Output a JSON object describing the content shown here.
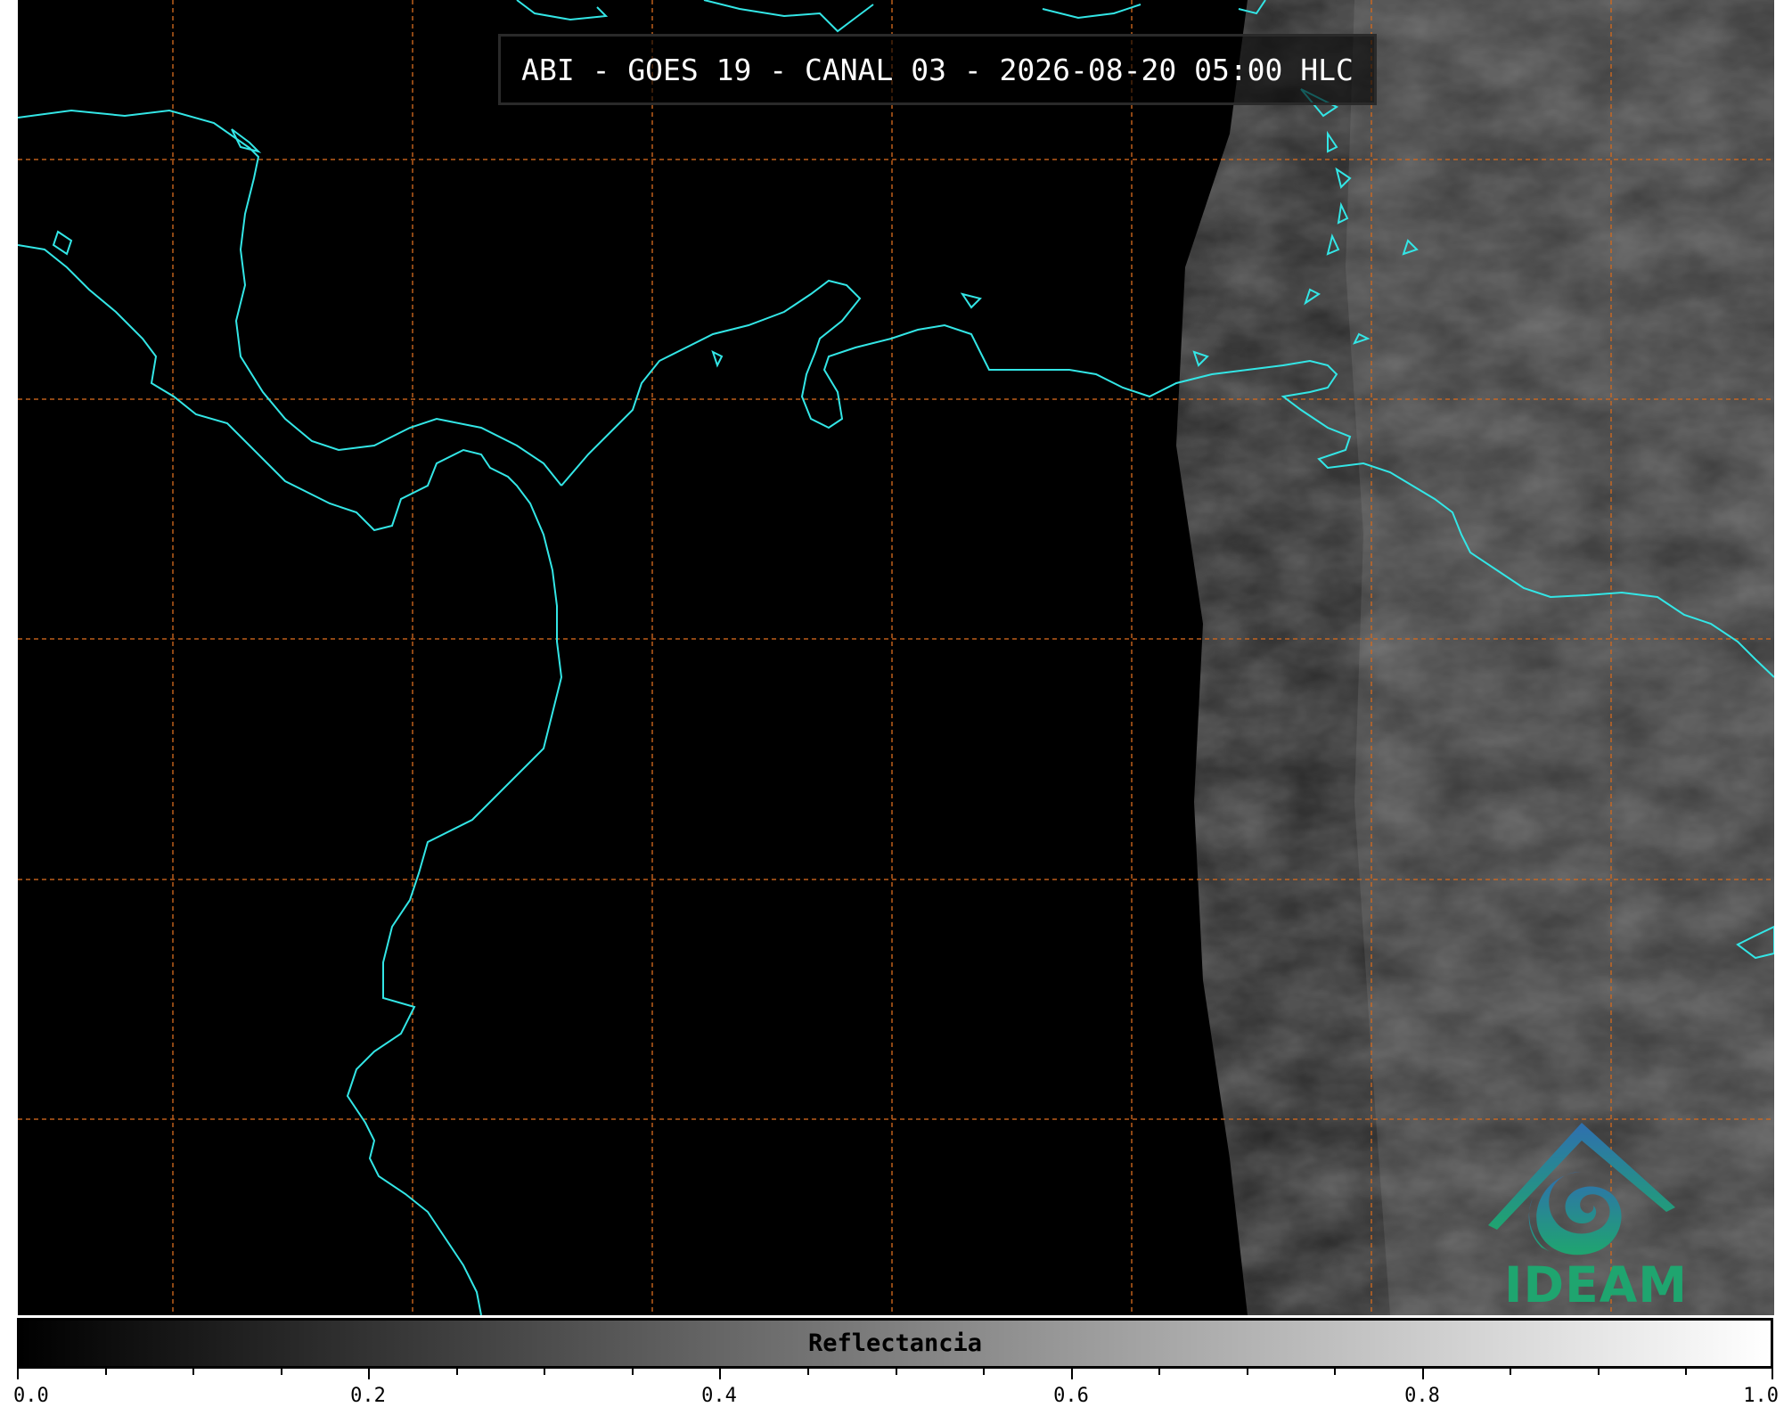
{
  "title": "ABI - GOES 19 - CANAL 03 - 2026-08-20 05:00 HLC",
  "colorbar": {
    "label": "Reflectancia",
    "ticks": [
      "0.0",
      "0.2",
      "0.4",
      "0.6",
      "0.8",
      "1.0"
    ],
    "range": [
      0.0,
      1.0
    ],
    "colormap": "grayscale black-to-white"
  },
  "logo": {
    "text": "IDEAM",
    "colors": {
      "roof": "#2f6fb0",
      "swirl": "#1fa56f"
    }
  },
  "colors": {
    "coastline": "#33e6e6",
    "gridlines": "#d2691e",
    "background": "#000000"
  },
  "map": {
    "gridlines": "dashed",
    "coverage": "night-side dark with sunlit clouds on the east",
    "icon": "map-icon"
  }
}
